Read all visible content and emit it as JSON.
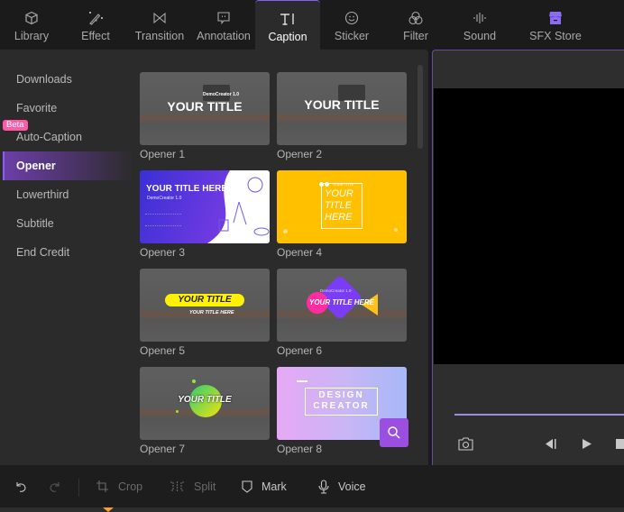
{
  "tabs": [
    {
      "label": "Library",
      "icon": "cube-icon"
    },
    {
      "label": "Effect",
      "icon": "magic-wand-icon"
    },
    {
      "label": "Transition",
      "icon": "bowtie-icon"
    },
    {
      "label": "Annotation",
      "icon": "speech-bubble-icon"
    },
    {
      "label": "Caption",
      "icon": "text-cursor-icon",
      "active": true
    },
    {
      "label": "Sticker",
      "icon": "smiley-icon"
    },
    {
      "label": "Filter",
      "icon": "circles-icon"
    },
    {
      "label": "Sound",
      "icon": "waveform-icon"
    },
    {
      "label": "SFX Store",
      "icon": "store-icon"
    }
  ],
  "categories": [
    {
      "label": "Downloads"
    },
    {
      "label": "Favorite"
    },
    {
      "label": "Auto-Caption",
      "badge": "Beta"
    },
    {
      "label": "Opener",
      "active": true
    },
    {
      "label": "Lowerthird"
    },
    {
      "label": "Subtitle"
    },
    {
      "label": "End Credit"
    }
  ],
  "templates": [
    {
      "name": "Opener 1",
      "title": "YOUR TITLE",
      "subtitle": "DemoCreator 1.0"
    },
    {
      "name": "Opener 2",
      "title": "YOUR TITLE"
    },
    {
      "name": "Opener 3",
      "title": "YOUR TITLE HERE",
      "subtitle": "DemoCreator 1.0"
    },
    {
      "name": "Opener 4",
      "title": "YOUR TITLE HERE",
      "subtitle": "YOUR TITLE"
    },
    {
      "name": "Opener 5",
      "title": "YOUR TITLE",
      "subtitle": "YOUR TITLE HERE"
    },
    {
      "name": "Opener 6",
      "title": "YOUR TITLE HERE",
      "subtitle": "DemoCreator 1.0"
    },
    {
      "name": "Opener 7",
      "title": "YOUR TITLE"
    },
    {
      "name": "Opener 8",
      "title_line1": "DESIGN",
      "title_line2": "CREATOR"
    }
  ],
  "colors": {
    "accent": "#8b5cf6",
    "beta_badge": "#ff5aa8",
    "progress": "#9c8ee0",
    "playhead": "#f5a623"
  },
  "preview": {
    "controls": [
      "snapshot-icon",
      "previous-frame-icon",
      "play-icon",
      "stop-icon"
    ]
  },
  "toolbar": {
    "undo_icon": "undo-icon",
    "redo_icon": "redo-icon",
    "crop_label": "Crop",
    "split_label": "Split",
    "mark_label": "Mark",
    "voice_label": "Voice"
  }
}
